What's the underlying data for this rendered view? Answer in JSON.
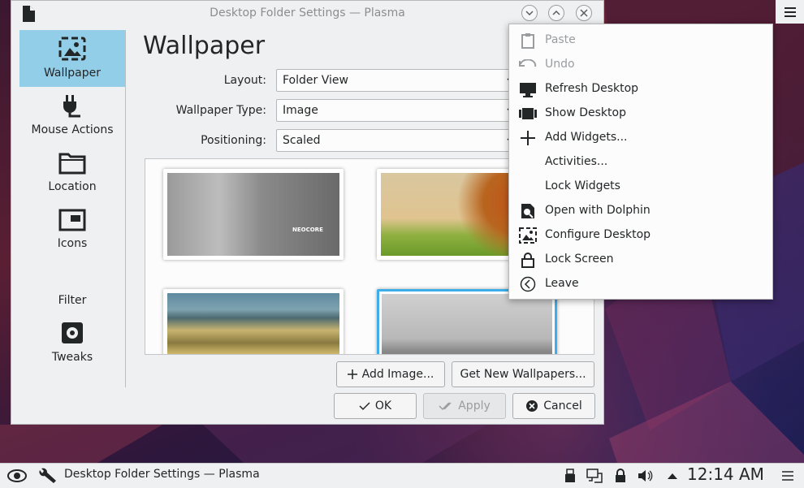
{
  "window": {
    "title": "Desktop Folder Settings — Plasma"
  },
  "sidebar": {
    "items": [
      {
        "label": "Wallpaper",
        "icon": "wallpaper-icon",
        "active": true
      },
      {
        "label": "Mouse Actions",
        "icon": "mouse-plug-icon",
        "active": false
      },
      {
        "label": "Location",
        "icon": "folder-icon",
        "active": false
      },
      {
        "label": "Icons",
        "icon": "icons-window-icon",
        "active": false
      },
      {
        "label": "Filter",
        "icon": "",
        "active": false
      },
      {
        "label": "Tweaks",
        "icon": "gear-icon",
        "active": false
      }
    ]
  },
  "main": {
    "title": "Wallpaper",
    "fields": [
      {
        "label": "Layout:",
        "value": "Folder View"
      },
      {
        "label": "Wallpaper Type:",
        "value": "Image"
      },
      {
        "label": "Positioning:",
        "value": "Scaled"
      }
    ],
    "thumbnails": [
      {
        "name": "gray-texture",
        "selected": false,
        "caption": "NEOCORE"
      },
      {
        "name": "autumn-tree",
        "selected": false
      },
      {
        "name": "yellow-lake",
        "selected": false
      },
      {
        "name": "foggy-pier",
        "selected": true
      }
    ]
  },
  "buttons": {
    "add_image": "Add Image...",
    "get_new": "Get New Wallpapers...",
    "ok": "OK",
    "apply": "Apply",
    "cancel": "Cancel"
  },
  "context_menu": {
    "items": [
      {
        "label": "Paste",
        "icon": "clipboard-icon",
        "disabled": true
      },
      {
        "label": "Undo",
        "icon": "undo-icon",
        "disabled": true
      },
      {
        "label": "Refresh Desktop",
        "icon": "monitor-icon",
        "disabled": false
      },
      {
        "label": "Show Desktop",
        "icon": "show-desktop-icon",
        "disabled": false
      },
      {
        "label": "Add Widgets...",
        "icon": "plus-icon",
        "disabled": false
      },
      {
        "label": "Activities...",
        "icon": "",
        "disabled": false
      },
      {
        "label": "Lock Widgets",
        "icon": "",
        "disabled": false
      },
      {
        "label": "Open with Dolphin",
        "icon": "dolphin-search-icon",
        "disabled": false
      },
      {
        "label": "Configure Desktop",
        "icon": "configure-desktop-icon",
        "disabled": false
      },
      {
        "label": "Lock Screen",
        "icon": "lock-icon",
        "disabled": false
      },
      {
        "label": "Leave",
        "icon": "leave-icon",
        "disabled": false
      }
    ]
  },
  "taskbar": {
    "task_label": "Desktop Folder Settings — Plasma",
    "clock": "12:14 AM"
  },
  "colors": {
    "accent": "#3daee9",
    "active_sidebar": "#93cee9"
  }
}
